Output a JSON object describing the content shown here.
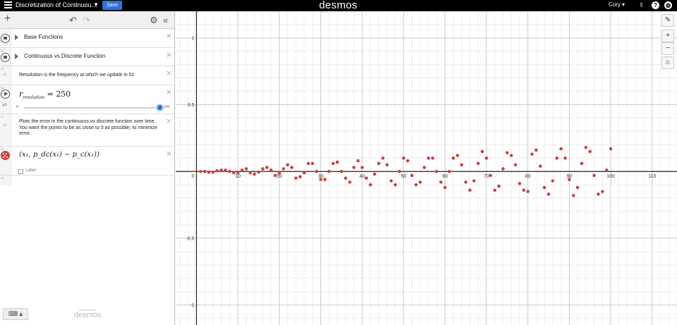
{
  "topbar": {
    "title": "Discretization of Continuou…",
    "save_label": "Save",
    "brand": "desmos",
    "user": "Cory ▾"
  },
  "icons": {
    "menu": "hamburger-icon",
    "add": "plus-icon",
    "undo": "undo-icon",
    "redo": "redo-icon",
    "settings": "gear-icon",
    "collapse": "double-chevron-left-icon",
    "wrench": "wrench-icon",
    "zoom_in": "zoom-in-icon",
    "zoom_out": "zoom-out-icon",
    "home": "home-icon",
    "keyboard": "keyboard-icon"
  },
  "toolbar": {
    "add": "+",
    "undo": "↶",
    "redo": "↷",
    "settings": "⚙",
    "collapse": "«"
  },
  "expressions": {
    "base_functions": {
      "label": "Base Functions"
    },
    "cont_vs_disc": {
      "label": "Continuous vs Discrete Function"
    },
    "resolution_note": {
      "text": "Resolution is the frequency at which we update in hz"
    },
    "slider": {
      "var": "r",
      "sub": "resolution",
      "value": "250",
      "min": "0",
      "max": "250",
      "fill": 1.0
    },
    "plot_note": {
      "text": "Plots the error in the continuous vs discrete function over time. You want the points to be as close to 0 as possible, to minimize error."
    },
    "points_expr": {
      "text": "(x₁, p_dc(x₁) − p_c(x₁))",
      "label": "Label"
    }
  },
  "powered": {
    "small": "powered by",
    "big": "desmos"
  },
  "graph_buttons": {
    "wrench": "🔧",
    "zoom_in": "+",
    "zoom_out": "−",
    "home": "⌂"
  },
  "colors": {
    "points": "#c74440",
    "accent": "#2f72dc"
  },
  "chart_data": {
    "type": "scatter",
    "xlim": [
      -5,
      116
    ],
    "ylim": [
      -1.15,
      1.2
    ],
    "x_ticks": [
      "10",
      "20",
      "30",
      "40",
      "50",
      "60",
      "70",
      "80",
      "90",
      "100",
      "110"
    ],
    "y_ticks": [
      "1",
      "0.5",
      "-0.5",
      "-1"
    ],
    "origin_label": "0",
    "grid": true,
    "series": [
      {
        "color": "#c74440",
        "points": [
          [
            1,
            0.0
          ],
          [
            2,
            0.0
          ],
          [
            3,
            -0.005
          ],
          [
            4,
            -0.005
          ],
          [
            5,
            0.005
          ],
          [
            6,
            0.01
          ],
          [
            7,
            0.01
          ],
          [
            8,
            0.0
          ],
          [
            9,
            -0.01
          ],
          [
            10,
            -0.01
          ],
          [
            11,
            0.01
          ],
          [
            12,
            0.02
          ],
          [
            13,
            -0.01
          ],
          [
            14,
            -0.02
          ],
          [
            15,
            -0.005
          ],
          [
            16,
            0.02
          ],
          [
            17,
            0.03
          ],
          [
            18,
            0.01
          ],
          [
            19,
            -0.03
          ],
          [
            20,
            -0.01
          ],
          [
            21,
            0.02
          ],
          [
            22,
            0.05
          ],
          [
            23,
            0.03
          ],
          [
            24,
            -0.05
          ],
          [
            25,
            -0.04
          ],
          [
            26,
            -0.01
          ],
          [
            27,
            0.06
          ],
          [
            28,
            0.06
          ],
          [
            29,
            0.0
          ],
          [
            30,
            -0.06
          ],
          [
            31,
            -0.06
          ],
          [
            32,
            0.0
          ],
          [
            33,
            0.06
          ],
          [
            34,
            0.07
          ],
          [
            35,
            0.0
          ],
          [
            36,
            -0.05
          ],
          [
            37,
            -0.08
          ],
          [
            38,
            0.03
          ],
          [
            39,
            0.08
          ],
          [
            40,
            0.03
          ],
          [
            41,
            -0.05
          ],
          [
            42,
            -0.1
          ],
          [
            43,
            -0.02
          ],
          [
            44,
            0.06
          ],
          [
            45,
            0.1
          ],
          [
            46,
            0.05
          ],
          [
            47,
            -0.07
          ],
          [
            48,
            -0.1
          ],
          [
            49,
            0.0
          ],
          [
            50,
            0.1
          ],
          [
            51,
            0.08
          ],
          [
            52,
            -0.03
          ],
          [
            53,
            -0.1
          ],
          [
            54,
            -0.08
          ],
          [
            55,
            0.03
          ],
          [
            56,
            0.1
          ],
          [
            57,
            0.1
          ],
          [
            58,
            0.0
          ],
          [
            59,
            -0.08
          ],
          [
            60,
            -0.12
          ],
          [
            61,
            0.0
          ],
          [
            62,
            0.1
          ],
          [
            63,
            0.12
          ],
          [
            64,
            0.05
          ],
          [
            65,
            -0.08
          ],
          [
            66,
            -0.14
          ],
          [
            67,
            -0.07
          ],
          [
            68,
            0.06
          ],
          [
            69,
            0.15
          ],
          [
            70,
            0.1
          ],
          [
            71,
            -0.03
          ],
          [
            72,
            -0.14
          ],
          [
            73,
            -0.11
          ],
          [
            74,
            0.02
          ],
          [
            75,
            0.14
          ],
          [
            76,
            0.12
          ],
          [
            77,
            0.05
          ],
          [
            78,
            -0.09
          ],
          [
            79,
            -0.14
          ],
          [
            80,
            -0.15
          ],
          [
            81,
            0.13
          ],
          [
            82,
            0.16
          ],
          [
            83,
            0.04
          ],
          [
            84,
            -0.12
          ],
          [
            85,
            -0.17
          ],
          [
            86,
            -0.07
          ],
          [
            87,
            0.1
          ],
          [
            88,
            0.17
          ],
          [
            89,
            0.1
          ],
          [
            90,
            -0.06
          ],
          [
            91,
            -0.18
          ],
          [
            92,
            -0.12
          ],
          [
            93,
            0.06
          ],
          [
            94,
            0.18
          ],
          [
            95,
            0.15
          ],
          [
            96,
            -0.03
          ],
          [
            97,
            -0.17
          ],
          [
            98,
            -0.15
          ],
          [
            99,
            0.01
          ],
          [
            100,
            0.17
          ]
        ]
      }
    ]
  }
}
